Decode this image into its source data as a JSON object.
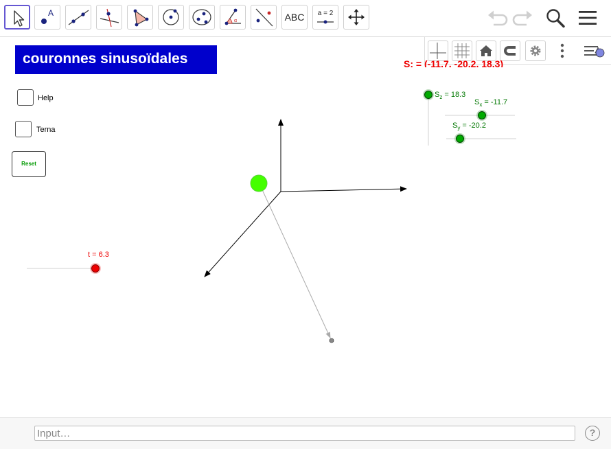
{
  "toolbar": {
    "text_tool_label": "ABC",
    "slider_tool_label": "a = 2",
    "tools": [
      "move-tool",
      "point-tool",
      "line-tool",
      "perpendicular-tool",
      "polygon-tool",
      "circle-tool",
      "conic-tool",
      "angle-tool",
      "reflect-tool",
      "text-tool",
      "slider-tool",
      "move-graphics-tool"
    ]
  },
  "title": "couronnes sinusoïdales",
  "checkboxes": [
    {
      "label": "Help",
      "checked": false
    },
    {
      "label": "Terna",
      "checked": false
    }
  ],
  "reset_label": "Reset",
  "sliders": {
    "t": {
      "label": "t = 6.3",
      "value": 6.3
    },
    "sz": {
      "label_main": "S",
      "label_sub": "z",
      "label_rest": " = 18.3",
      "value": 18.3
    },
    "sx": {
      "label_main": "S",
      "label_sub": "x",
      "label_rest": " = -11.7",
      "value": -11.7
    },
    "sy": {
      "label_main": "S",
      "label_sub": "y",
      "label_rest": " = -20.2",
      "value": -20.2
    }
  },
  "point_s_label": "S: = (-11.7, -20.2, 18.3)",
  "input_bar": {
    "placeholder": "Input…"
  },
  "help_symbol": "?",
  "colors": {
    "title_bg": "#0000cc",
    "slider_green": "#007700",
    "slider_red": "#ee0000",
    "point_green": "#44ff00",
    "active_tool_border": "#6557d2"
  }
}
